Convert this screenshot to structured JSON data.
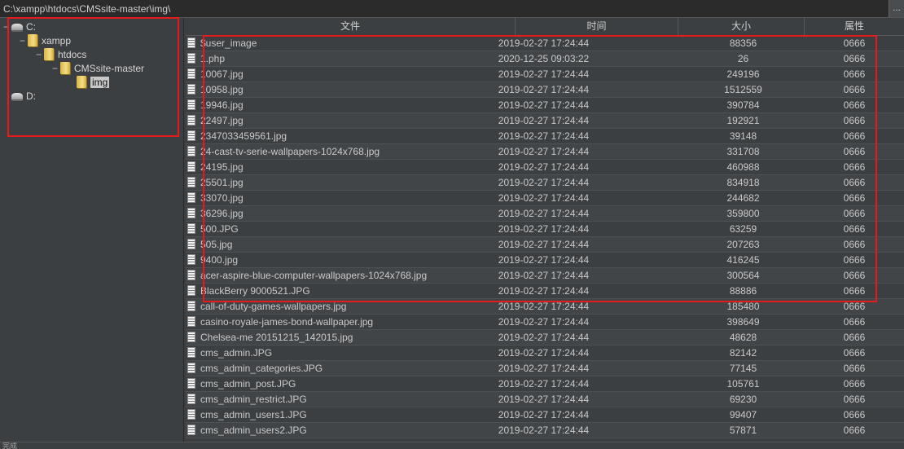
{
  "path": "C:\\xampp\\htdocs\\CMSsite-master\\img\\",
  "path_button": "…",
  "tree": [
    {
      "label": "C:",
      "type": "drive",
      "depth": 0,
      "expander": "−"
    },
    {
      "label": "xampp",
      "type": "folder",
      "depth": 1,
      "expander": "−"
    },
    {
      "label": "htdocs",
      "type": "folder",
      "depth": 2,
      "expander": "−"
    },
    {
      "label": "CMSsite-master",
      "type": "folder",
      "depth": 3,
      "expander": "−"
    },
    {
      "label": "img",
      "type": "folder",
      "depth": 4,
      "expander": "",
      "selected": true
    },
    {
      "label": "D:",
      "type": "drive",
      "depth": 0,
      "expander": ""
    }
  ],
  "columns": {
    "name": "文件",
    "time": "时间",
    "size": "大小",
    "attr": "属性"
  },
  "files": [
    {
      "name": "$user_image",
      "time": "2019-02-27 17:24:44",
      "size": "88356",
      "attr": "0666"
    },
    {
      "name": "1.php",
      "time": "2020-12-25 09:03:22",
      "size": "26",
      "attr": "0666"
    },
    {
      "name": "10067.jpg",
      "time": "2019-02-27 17:24:44",
      "size": "249196",
      "attr": "0666"
    },
    {
      "name": "10958.jpg",
      "time": "2019-02-27 17:24:44",
      "size": "1512559",
      "attr": "0666"
    },
    {
      "name": "19946.jpg",
      "time": "2019-02-27 17:24:44",
      "size": "390784",
      "attr": "0666"
    },
    {
      "name": "22497.jpg",
      "time": "2019-02-27 17:24:44",
      "size": "192921",
      "attr": "0666"
    },
    {
      "name": "2347033459561.jpg",
      "time": "2019-02-27 17:24:44",
      "size": "39148",
      "attr": "0666"
    },
    {
      "name": "24-cast-tv-serie-wallpapers-1024x768.jpg",
      "time": "2019-02-27 17:24:44",
      "size": "331708",
      "attr": "0666"
    },
    {
      "name": "24195.jpg",
      "time": "2019-02-27 17:24:44",
      "size": "460988",
      "attr": "0666"
    },
    {
      "name": "25501.jpg",
      "time": "2019-02-27 17:24:44",
      "size": "834918",
      "attr": "0666"
    },
    {
      "name": "33070.jpg",
      "time": "2019-02-27 17:24:44",
      "size": "244682",
      "attr": "0666"
    },
    {
      "name": "36296.jpg",
      "time": "2019-02-27 17:24:44",
      "size": "359800",
      "attr": "0666"
    },
    {
      "name": "500.JPG",
      "time": "2019-02-27 17:24:44",
      "size": "63259",
      "attr": "0666"
    },
    {
      "name": "505.jpg",
      "time": "2019-02-27 17:24:44",
      "size": "207263",
      "attr": "0666"
    },
    {
      "name": "9400.jpg",
      "time": "2019-02-27 17:24:44",
      "size": "416245",
      "attr": "0666"
    },
    {
      "name": "acer-aspire-blue-computer-wallpapers-1024x768.jpg",
      "time": "2019-02-27 17:24:44",
      "size": "300564",
      "attr": "0666"
    },
    {
      "name": "BlackBerry 9000521.JPG",
      "time": "2019-02-27 17:24:44",
      "size": "88886",
      "attr": "0666"
    },
    {
      "name": "call-of-duty-games-wallpapers.jpg",
      "time": "2019-02-27 17:24:44",
      "size": "185480",
      "attr": "0666"
    },
    {
      "name": "casino-royale-james-bond-wallpaper.jpg",
      "time": "2019-02-27 17:24:44",
      "size": "398649",
      "attr": "0666"
    },
    {
      "name": "Chelsea-me 20151215_142015.jpg",
      "time": "2019-02-27 17:24:44",
      "size": "48628",
      "attr": "0666"
    },
    {
      "name": "cms_admin.JPG",
      "time": "2019-02-27 17:24:44",
      "size": "82142",
      "attr": "0666"
    },
    {
      "name": "cms_admin_categories.JPG",
      "time": "2019-02-27 17:24:44",
      "size": "77145",
      "attr": "0666"
    },
    {
      "name": "cms_admin_post.JPG",
      "time": "2019-02-27 17:24:44",
      "size": "105761",
      "attr": "0666"
    },
    {
      "name": "cms_admin_restrict.JPG",
      "time": "2019-02-27 17:24:44",
      "size": "69230",
      "attr": "0666"
    },
    {
      "name": "cms_admin_users1.JPG",
      "time": "2019-02-27 17:24:44",
      "size": "99407",
      "attr": "0666"
    },
    {
      "name": "cms_admin_users2.JPG",
      "time": "2019-02-27 17:24:44",
      "size": "57871",
      "attr": "0666"
    }
  ],
  "status_text": "完成",
  "colors": {
    "highlight_box": "#e31b1b",
    "background": "#3c3f41",
    "text": "#c9c9c9"
  }
}
